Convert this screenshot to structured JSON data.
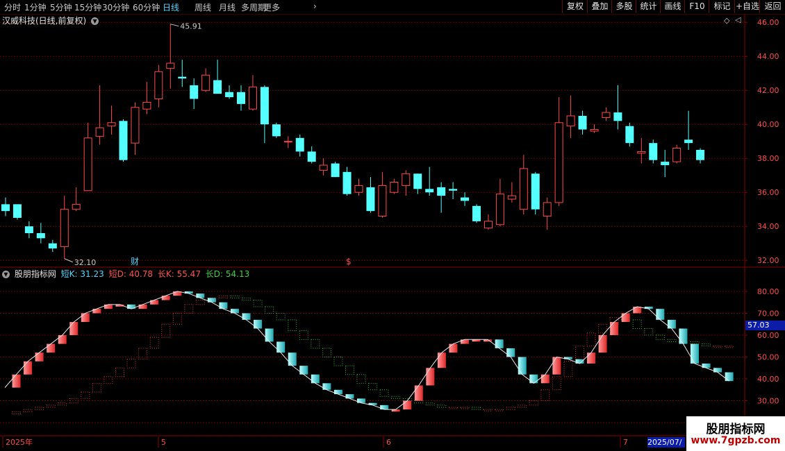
{
  "toolbar": {
    "periods": [
      "分时",
      "1分钟",
      "5分钟",
      "15分钟",
      "30分钟",
      "60分钟",
      "日线",
      "周线",
      "月线",
      "多周期",
      "更多"
    ],
    "active_period": "日线",
    "buttons": [
      "复权",
      "叠加",
      "多股",
      "统计",
      "画线",
      "F10",
      "标记",
      "+自选",
      "返回"
    ]
  },
  "main_chart": {
    "title": "汉威科技(日线,前复权)",
    "y_ticks": [
      "46.00",
      "44.00",
      "42.00",
      "40.00",
      "38.00",
      "36.00",
      "34.00",
      "32.00"
    ],
    "high_marker": "45.91",
    "low_marker": "32.10",
    "event_marker_cai": "财",
    "event_marker_dollar": "$"
  },
  "indicator": {
    "name": "股朋指标网",
    "short_k_label": "短K: 31.23",
    "short_d_label": "短D: 40.78",
    "long_k_label": "长K: 55.47",
    "long_d_label": "长D: 54.13",
    "y_ticks": [
      "80.00",
      "70.00",
      "60.00",
      "50.00",
      "40.00",
      "30.00",
      "20.00"
    ],
    "current_value": "57.03"
  },
  "date_axis": {
    "labels": [
      "2025年",
      "5",
      "6",
      "7"
    ],
    "cursor_date": "2025/07/"
  },
  "watermark": {
    "title": "股朋指标网",
    "url": "www.7gpzb.com"
  },
  "colors": {
    "up": "#ff4a4a",
    "down": "#54ffff",
    "background": "#000000",
    "grid": "#6a0000",
    "long_k_up": "#d23030",
    "long_k_down": "#34b534"
  },
  "chart_data": {
    "type": "candlestick",
    "ohlc": [
      [
        35.3,
        35.7,
        34.6,
        34.9
      ],
      [
        35.3,
        35.3,
        34.4,
        34.5
      ],
      [
        34.0,
        34.3,
        33.3,
        33.6
      ],
      [
        33.6,
        34.2,
        33.0,
        33.3
      ],
      [
        33.0,
        33.2,
        32.5,
        32.7
      ],
      [
        32.8,
        35.8,
        32.1,
        35.0
      ],
      [
        35.0,
        36.3,
        34.9,
        35.3
      ],
      [
        36.1,
        40.1,
        36.1,
        39.2
      ],
      [
        39.3,
        42.3,
        38.8,
        39.8
      ],
      [
        39.9,
        41.1,
        39.4,
        40.1
      ],
      [
        40.2,
        40.3,
        37.8,
        37.9
      ],
      [
        38.9,
        41.3,
        38.2,
        41.0
      ],
      [
        40.9,
        42.5,
        40.6,
        41.3
      ],
      [
        41.5,
        43.5,
        41.0,
        43.1
      ],
      [
        43.3,
        45.9,
        42.1,
        43.6
      ],
      [
        42.8,
        43.8,
        42.2,
        42.7
      ],
      [
        42.3,
        42.7,
        40.9,
        41.5
      ],
      [
        42.0,
        43.3,
        41.9,
        42.9
      ],
      [
        42.6,
        43.8,
        41.9,
        41.8
      ],
      [
        41.9,
        42.3,
        41.5,
        41.6
      ],
      [
        41.9,
        42.3,
        40.8,
        41.2
      ],
      [
        40.9,
        42.9,
        40.8,
        42.2
      ],
      [
        42.2,
        42.3,
        38.9,
        40.0
      ],
      [
        40.0,
        40.1,
        39.2,
        39.3
      ],
      [
        39.0,
        39.3,
        38.6,
        39.0
      ],
      [
        39.2,
        39.4,
        38.1,
        38.4
      ],
      [
        38.4,
        38.7,
        37.7,
        37.8
      ],
      [
        37.3,
        38.0,
        37.0,
        37.6
      ],
      [
        37.7,
        37.8,
        36.9,
        36.9
      ],
      [
        37.2,
        37.5,
        35.8,
        35.9
      ],
      [
        36.0,
        36.8,
        35.8,
        36.4
      ],
      [
        36.3,
        36.9,
        34.8,
        34.9
      ],
      [
        34.6,
        37.2,
        34.5,
        36.4
      ],
      [
        36.0,
        36.8,
        35.9,
        36.6
      ],
      [
        36.4,
        37.3,
        35.8,
        37.1
      ],
      [
        37.1,
        37.1,
        35.9,
        36.2
      ],
      [
        36.2,
        37.5,
        35.8,
        36.0
      ],
      [
        36.3,
        36.6,
        34.8,
        35.8
      ],
      [
        36.2,
        36.6,
        35.6,
        36.1
      ],
      [
        35.7,
        36.0,
        35.2,
        35.5
      ],
      [
        35.2,
        35.3,
        34.2,
        34.3
      ],
      [
        33.9,
        34.7,
        33.8,
        34.3
      ],
      [
        34.1,
        36.8,
        34.0,
        35.9
      ],
      [
        35.6,
        36.6,
        35.4,
        35.8
      ],
      [
        35.0,
        38.2,
        34.7,
        37.4
      ],
      [
        37.1,
        37.2,
        34.7,
        35.0
      ],
      [
        34.6,
        35.7,
        33.8,
        35.4
      ],
      [
        35.4,
        41.6,
        35.2,
        40.1
      ],
      [
        39.9,
        41.7,
        39.2,
        40.5
      ],
      [
        40.5,
        40.8,
        39.4,
        39.7
      ],
      [
        39.6,
        40.0,
        39.5,
        39.7
      ],
      [
        40.4,
        41.0,
        40.2,
        40.7
      ],
      [
        40.7,
        42.3,
        39.7,
        40.2
      ],
      [
        39.9,
        40.1,
        38.7,
        38.9
      ],
      [
        38.3,
        39.2,
        37.7,
        38.4
      ],
      [
        38.9,
        39.1,
        37.7,
        37.9
      ],
      [
        37.8,
        38.5,
        36.9,
        37.6
      ],
      [
        37.8,
        38.8,
        37.7,
        38.6
      ],
      [
        39.1,
        40.8,
        38.5,
        38.9
      ],
      [
        38.5,
        38.6,
        37.7,
        37.9
      ]
    ],
    "short_k": [
      36,
      42,
      48,
      52,
      56,
      60,
      66,
      70,
      72,
      74,
      74,
      72,
      74,
      76,
      78,
      80,
      79,
      77,
      75,
      72,
      70,
      67,
      63,
      57,
      52,
      46,
      42,
      38,
      35,
      33,
      31,
      29,
      28,
      26,
      26,
      30,
      37,
      45,
      52,
      56,
      58,
      58,
      58,
      54,
      50,
      42,
      38,
      42,
      50,
      49,
      47,
      52,
      60,
      66,
      70,
      73,
      72,
      67,
      63,
      56,
      47,
      45,
      43,
      39
    ],
    "short_d": [
      null,
      null,
      null,
      null,
      null,
      null,
      null,
      null,
      null,
      null,
      null,
      null,
      null,
      null,
      null,
      null,
      null,
      null,
      null,
      null,
      null,
      null,
      null,
      null,
      null,
      null,
      null,
      null,
      null,
      null,
      null,
      null,
      null,
      null,
      null,
      null,
      null,
      null,
      null,
      null,
      null,
      null,
      null,
      null,
      null,
      null,
      null,
      null,
      null,
      null,
      null,
      null,
      null,
      null,
      null,
      null,
      null,
      null,
      null,
      null,
      null,
      null,
      null,
      40.78
    ],
    "long_k": [
      24,
      25,
      26,
      27,
      28,
      29,
      31,
      34,
      38,
      41,
      45,
      49,
      54,
      59,
      65,
      70,
      74,
      76,
      77,
      78,
      77,
      76,
      73,
      70,
      67,
      62,
      58,
      54,
      50,
      46,
      42,
      38,
      35,
      32,
      31,
      30,
      29,
      28,
      27,
      27,
      27,
      26,
      26,
      26,
      27,
      28,
      30,
      35,
      41,
      48,
      55,
      61,
      65,
      68,
      67,
      63,
      60,
      58,
      57,
      57,
      56,
      55,
      55,
      55
    ],
    "x_labels": [
      "2025年",
      "5",
      "6",
      "7"
    ],
    "ylim_price": [
      31.6,
      46.5
    ],
    "ylim_indicator": [
      14,
      86
    ],
    "title": "汉威科技(日线,前复权)"
  }
}
